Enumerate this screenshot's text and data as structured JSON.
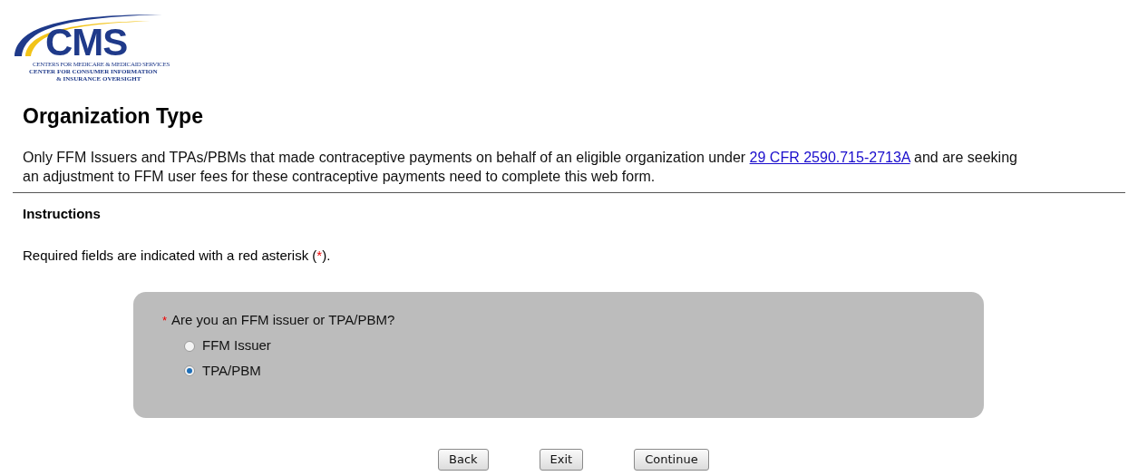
{
  "logo": {
    "wordmark": "CMS",
    "line_1": "CENTERS FOR MEDICARE & MEDICAID SERVICES",
    "line_2": "CENTER FOR CONSUMER INFORMATION",
    "line_3": "& INSURANCE OVERSIGHT"
  },
  "title": "Organization Type",
  "intro": {
    "before": "Only FFM Issuers and TPAs/PBMs that made contraceptive payments on behalf of an eligible organization under ",
    "link": "29 CFR 2590.715-2713A",
    "after": " and are seeking an adjustment to FFM user fees for these contraceptive payments need to complete this web form."
  },
  "instructions": {
    "heading": "Instructions",
    "before": "Required fields are indicated with a red asterisk (",
    "asterisk": "*",
    "after": ")."
  },
  "question": {
    "required_mark": "*",
    "label": "Are you an FFM issuer or TPA/PBM?",
    "options": [
      {
        "label": "FFM Issuer",
        "selected": false
      },
      {
        "label": "TPA/PBM",
        "selected": true
      }
    ]
  },
  "buttons": [
    "Back",
    "Exit",
    "Continue"
  ]
}
